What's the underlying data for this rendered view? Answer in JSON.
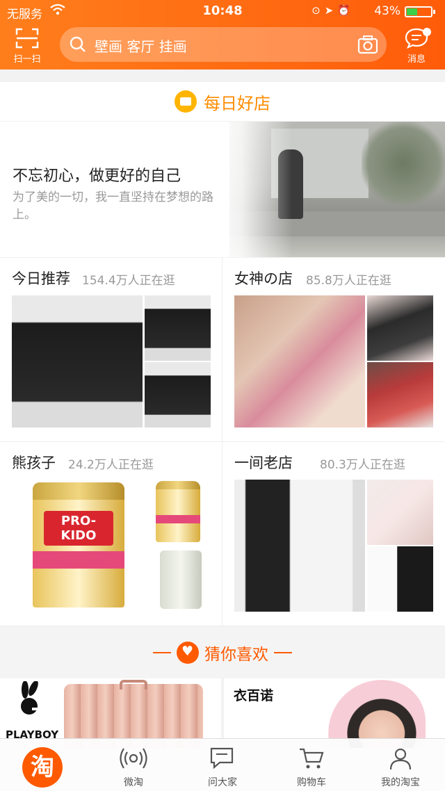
{
  "status_bar": {
    "carrier": "无服务",
    "time": "10:48",
    "battery_percent": "43%",
    "battery_level": 0.43,
    "icons": [
      "wifi-icon",
      "orientation-lock-icon",
      "location-icon",
      "alarm-icon",
      "battery-icon"
    ]
  },
  "header": {
    "scan_label": "扫一扫",
    "search_placeholder": "壁画 客厅 挂画",
    "message_label": "消息",
    "accent_color": "#ff6a10"
  },
  "daily_shop": {
    "title": "每日好店",
    "banner_headline": "不忘初心，做更好的自己",
    "banner_sub": "为了美的一切，我一直坚持在梦想的路上。"
  },
  "shops": [
    {
      "name": "今日推荐",
      "visitors": "154.4万人正在逛"
    },
    {
      "name": "女神の店",
      "visitors": "85.8万人正在逛"
    },
    {
      "name": "熊孩子",
      "visitors": "24.2万人正在逛"
    },
    {
      "name": "一间老店",
      "visitors": "80.3万人正在逛"
    }
  ],
  "guess": {
    "title": "猜你喜欢"
  },
  "recommendations": [
    {
      "brand": "PLAYBOY"
    },
    {
      "brand": "衣百诺"
    }
  ],
  "tabbar": {
    "home_logo": "淘",
    "tabs": [
      {
        "label": "微淘"
      },
      {
        "label": "问大家"
      },
      {
        "label": "购物车"
      },
      {
        "label": "我的淘宝"
      }
    ]
  }
}
